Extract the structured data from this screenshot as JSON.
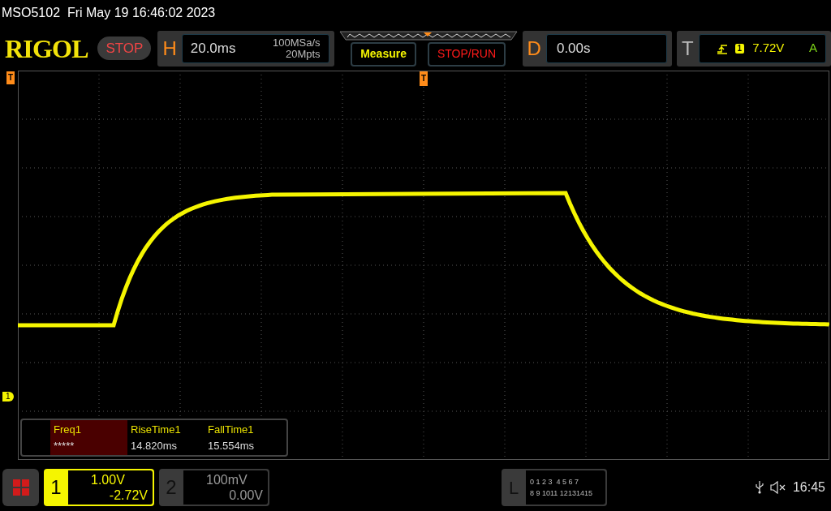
{
  "header": {
    "model_datetime": "MSO5102  Fri May 19 16:46:02 2023"
  },
  "toolbar": {
    "logo": "RIGOL",
    "run_state": "STOP",
    "horizontal": {
      "label": "H",
      "timebase": "20.0ms",
      "sample_rate": "100MSa/s",
      "memory_depth": "20Mpts"
    },
    "buttons": [
      {
        "label": "Measure",
        "kind": "measure"
      },
      {
        "label": "STOP/RUN",
        "kind": "stoprun"
      }
    ],
    "delay": {
      "label": "D",
      "value": "0.00s"
    },
    "trigger": {
      "label": "T",
      "source": "1",
      "level": "7.72V",
      "mode": "A"
    }
  },
  "display": {
    "left_trigger_marker": "T",
    "top_trigger_marker": "T",
    "channel_marker": "1"
  },
  "measurements": [
    {
      "name": "Freq1",
      "value": "*****",
      "selected": true
    },
    {
      "name": "RiseTime1",
      "value": "14.820ms",
      "selected": false
    },
    {
      "name": "FallTime1",
      "value": "15.554ms",
      "selected": false
    }
  ],
  "channels": [
    {
      "number": "1",
      "scale": "1.00V",
      "offset": "-2.72V",
      "enabled": true
    },
    {
      "number": "2",
      "scale": "100mV",
      "offset": "0.00V",
      "enabled": false
    }
  ],
  "logic": {
    "label": "L",
    "row_1": "0 1 2 3  4 5 6 7",
    "row_2": "8 9 1011 12131415"
  },
  "status": {
    "time": "16:45"
  }
}
